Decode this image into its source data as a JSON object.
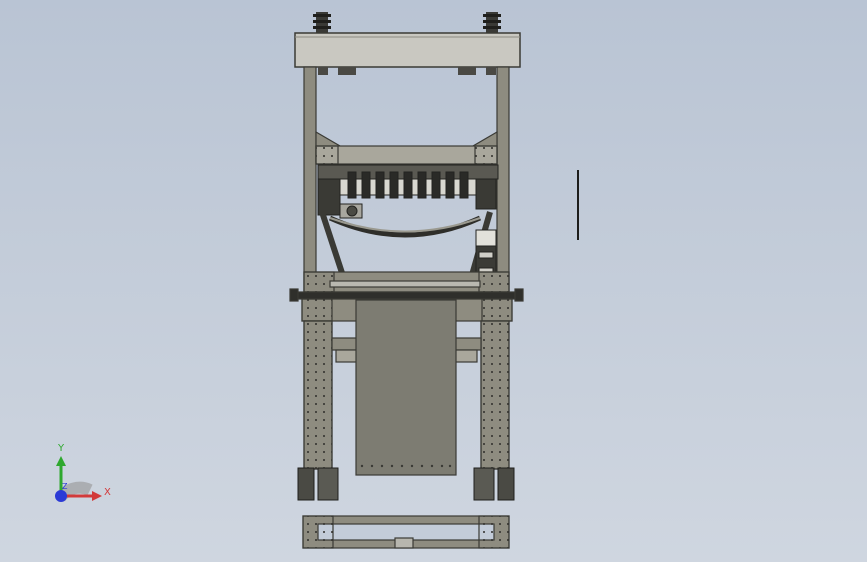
{
  "viewport": {
    "background_top": "#b9c4d4",
    "background_bottom": "#cfd6e0"
  },
  "model": {
    "frame_color": "#8e8c80",
    "frame_dark": "#3d3c37",
    "panel_color": "#7c7b70",
    "header_color": "#c7c6bf"
  },
  "triad": {
    "y_label": "Y",
    "x_label": "X",
    "z_label": "Z",
    "y_color": "#2ea82e",
    "x_color": "#d23a3a",
    "z_color": "#2b3ad6"
  }
}
